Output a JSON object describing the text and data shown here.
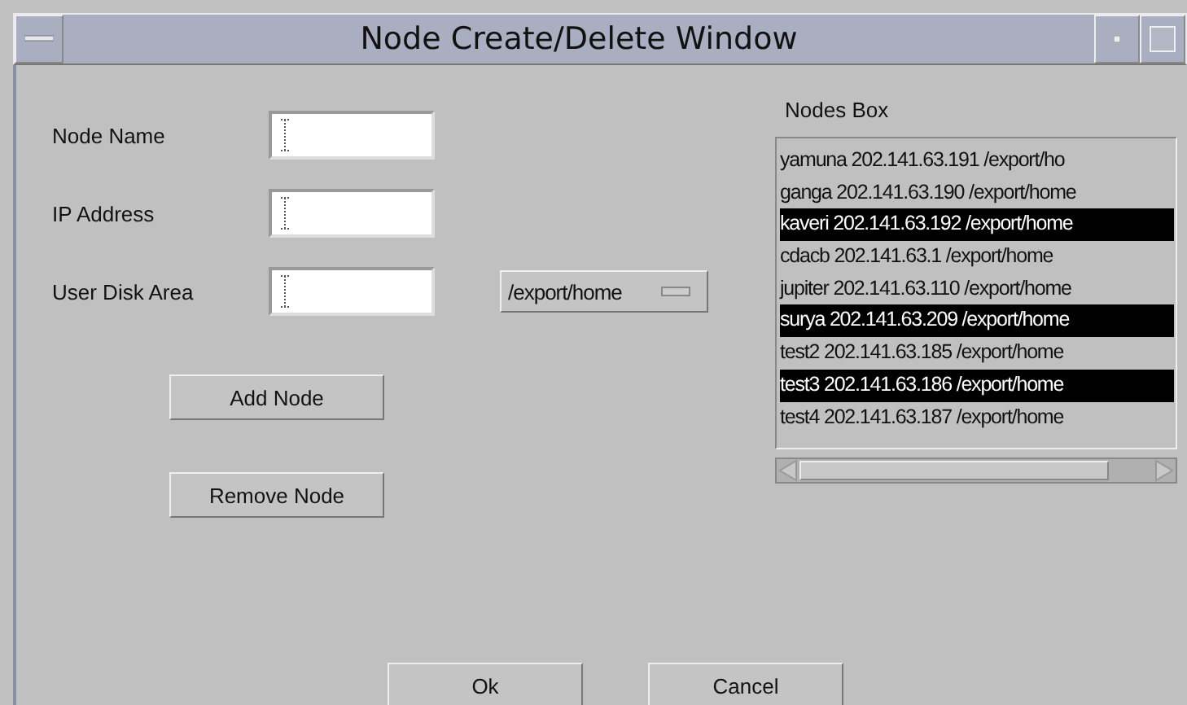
{
  "window": {
    "title": "Node Create/Delete Window"
  },
  "fields": [
    {
      "label": "Node Name"
    },
    {
      "label": "IP Address"
    },
    {
      "label": "User Disk Area"
    }
  ],
  "disk_dropdown": {
    "value": "/export/home"
  },
  "buttons": [
    "Add Node",
    "Remove Node"
  ],
  "nodes_box": {
    "label": "Nodes Box",
    "items": [
      {
        "text": "yamuna 202.141.63.191 /export/ho",
        "selected": false
      },
      {
        "text": "ganga 202.141.63.190 /export/home",
        "selected": false
      },
      {
        "text": "kaveri 202.141.63.192 /export/home",
        "selected": true
      },
      {
        "text": "cdacb 202.141.63.1 /export/home",
        "selected": false
      },
      {
        "text": "jupiter 202.141.63.110 /export/home",
        "selected": false
      },
      {
        "text": "surya 202.141.63.209 /export/home",
        "selected": true
      },
      {
        "text": "test2 202.141.63.185 /export/home",
        "selected": false
      },
      {
        "text": "test3 202.141.63.186 /export/home",
        "selected": true
      },
      {
        "text": "test4 202.141.63.187 /export/home",
        "selected": false
      }
    ]
  },
  "dialog_buttons": [
    "Ok",
    "Cancel"
  ]
}
